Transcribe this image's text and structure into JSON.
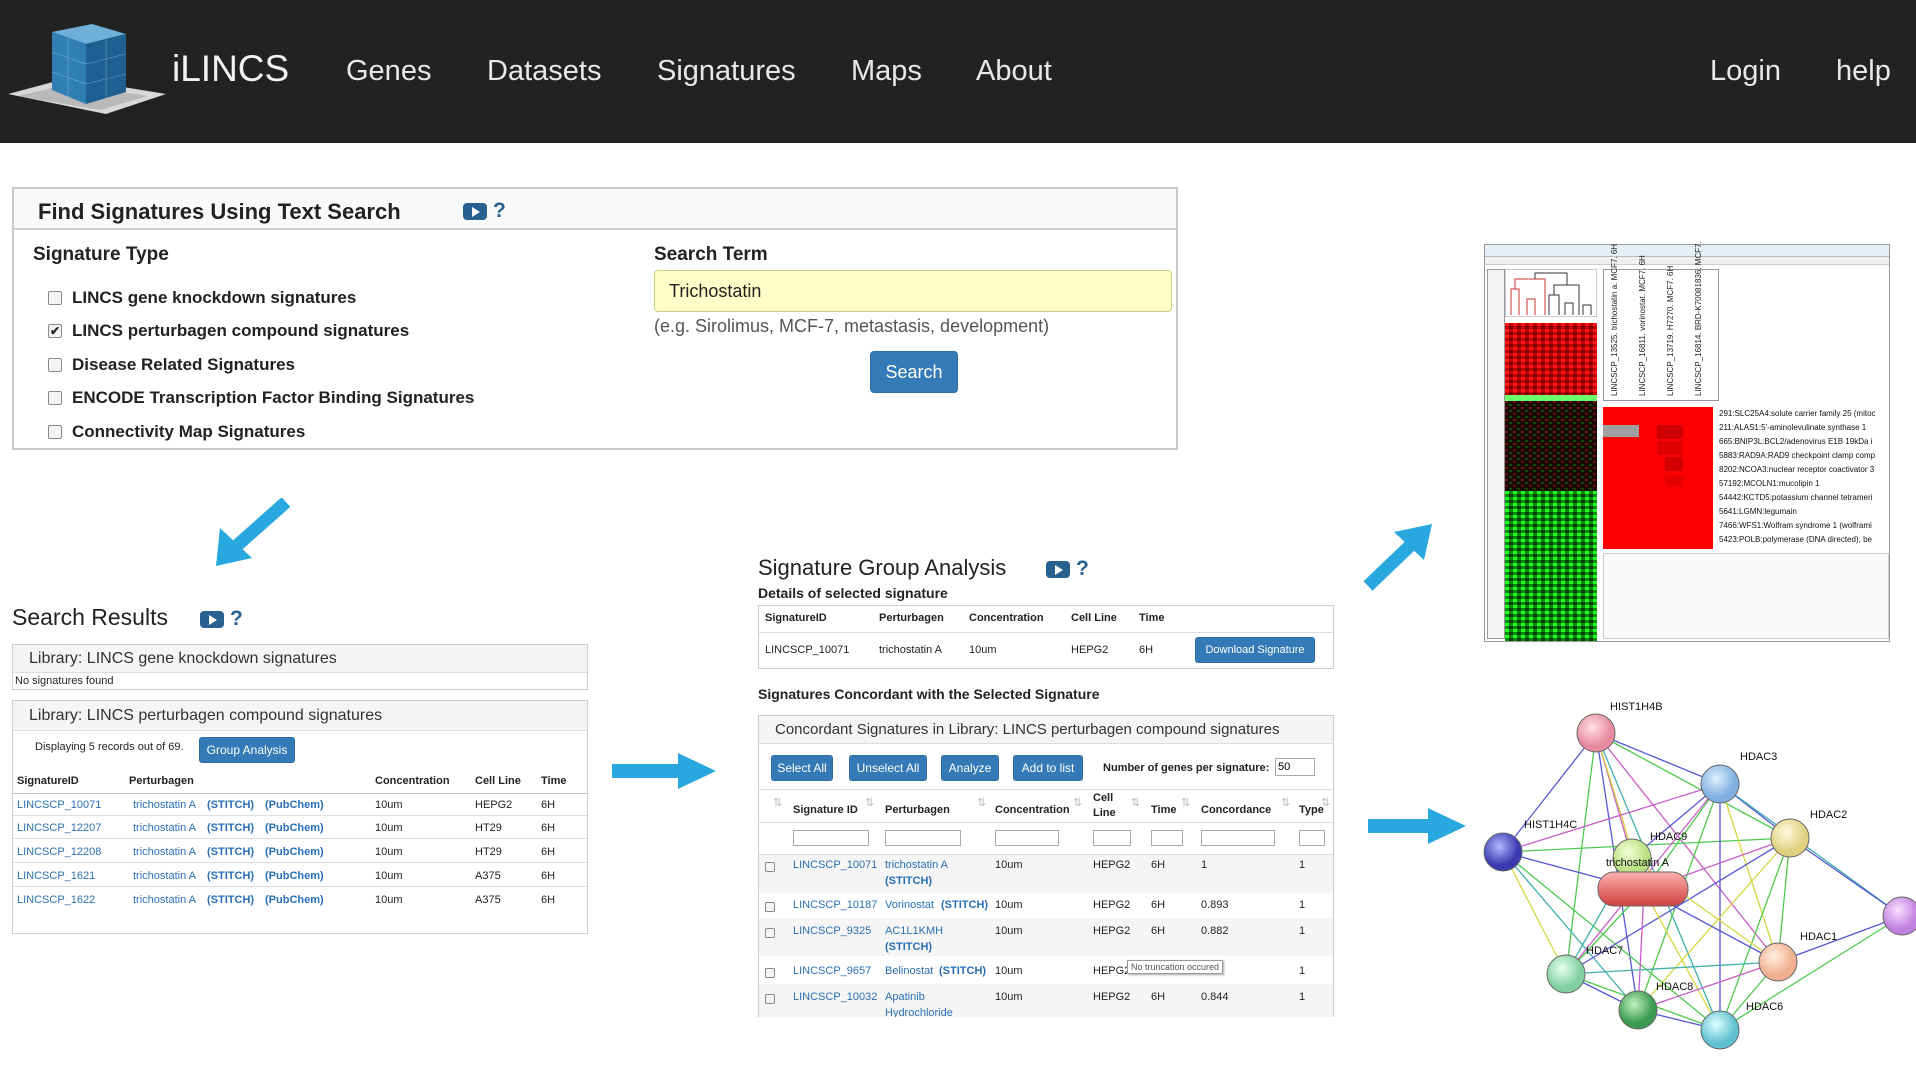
{
  "navbar": {
    "brand": "iLINCS",
    "links": [
      "Genes",
      "Datasets",
      "Signatures",
      "Maps",
      "About"
    ],
    "login": "Login",
    "help": "help"
  },
  "find": {
    "title": "Find Signatures Using Text Search",
    "signature_type_label": "Signature Type",
    "types": [
      {
        "label": "LINCS gene knockdown signatures",
        "checked": false
      },
      {
        "label": "LINCS perturbagen compound signatures",
        "checked": true
      },
      {
        "label": "Disease Related Signatures",
        "checked": false
      },
      {
        "label": "ENCODE Transcription Factor Binding Signatures",
        "checked": false
      },
      {
        "label": "Connectivity Map Signatures",
        "checked": false
      }
    ],
    "search_term_label": "Search Term",
    "search_value": "Trichostatin",
    "hint": "(e.g. Sirolimus, MCF-7, metastasis, development)",
    "search_button": "Search",
    "help_mark": "?"
  },
  "results": {
    "title": "Search Results",
    "help_mark": "?",
    "lib1": {
      "title": "Library: LINCS gene knockdown signatures",
      "empty": "No signatures found"
    },
    "lib2": {
      "title": "Library: LINCS perturbagen compound signatures",
      "count_text": "Displaying 5 records out of 69.",
      "group_button": "Group Analysis",
      "columns": [
        "SignatureID",
        "Perturbagen",
        "Concentration",
        "Cell Line",
        "Time"
      ],
      "rows": [
        {
          "id": "LINCSCP_10071",
          "pert": "trichostatin A",
          "stitch": "(STITCH)",
          "pubchem": "(PubChem)",
          "conc": "10um",
          "cell": "HEPG2",
          "time": "6H"
        },
        {
          "id": "LINCSCP_12207",
          "pert": "trichostatin A",
          "stitch": "(STITCH)",
          "pubchem": "(PubChem)",
          "conc": "10um",
          "cell": "HT29",
          "time": "6H"
        },
        {
          "id": "LINCSCP_12208",
          "pert": "trichostatin A",
          "stitch": "(STITCH)",
          "pubchem": "(PubChem)",
          "conc": "10um",
          "cell": "HT29",
          "time": "6H"
        },
        {
          "id": "LINCSCP_1621",
          "pert": "trichostatin A",
          "stitch": "(STITCH)",
          "pubchem": "(PubChem)",
          "conc": "10um",
          "cell": "A375",
          "time": "6H"
        },
        {
          "id": "LINCSCP_1622",
          "pert": "trichostatin A",
          "stitch": "(STITCH)",
          "pubchem": "(PubChem)",
          "conc": "10um",
          "cell": "A375",
          "time": "6H"
        }
      ]
    }
  },
  "sga": {
    "title": "Signature Group Analysis",
    "help_mark": "?",
    "details_label": "Details of selected signature",
    "columns": [
      "SignatureID",
      "Perturbagen",
      "Concentration",
      "Cell Line",
      "Time"
    ],
    "row": {
      "id": "LINCSCP_10071",
      "pert": "trichostatin A",
      "conc": "10um",
      "cell": "HEPG2",
      "time": "6H"
    },
    "download_button": "Download Signature",
    "concordant_label": "Signatures Concordant with the Selected Signature",
    "concordant_box_title": "Concordant Signatures in Library: LINCS perturbagen compound signatures",
    "buttons": [
      "Select All",
      "Unselect All",
      "Analyze",
      "Add to list"
    ],
    "genes_label": "Number of genes per signature:",
    "genes_value": "50",
    "table_columns": [
      "Signature ID",
      "Perturbagen",
      "Concentration",
      "Cell Line",
      "Time",
      "Concordance",
      "Type"
    ],
    "table_rows": [
      {
        "id": "LINCSCP_10071",
        "pert": "trichostatin A",
        "pert2": "(STITCH)",
        "conc": "10um",
        "cell": "HEPG2",
        "time": "6H",
        "concordance": "1",
        "type": "1"
      },
      {
        "id": "LINCSCP_10187",
        "pert": "Vorinostat",
        "pert_stitch": "(STITCH)",
        "conc": "10um",
        "cell": "HEPG2",
        "time": "6H",
        "concordance": "0.893",
        "type": "1"
      },
      {
        "id": "LINCSCP_9325",
        "pert": "AC1L1KMH",
        "pert2": "(STITCH)",
        "conc": "10um",
        "cell": "HEPG2",
        "time": "6H",
        "concordance": "0.882",
        "type": "1"
      },
      {
        "id": "LINCSCP_9657",
        "pert": "Belinostat",
        "pert_stitch": "(STITCH)",
        "conc": "10um",
        "cell": "HEPG2",
        "time": "",
        "concordance": "",
        "type": "1"
      },
      {
        "id": "LINCSCP_10032",
        "pert": "Apatinib",
        "pert2": "Hydrochloride",
        "conc": "10um",
        "cell": "HEPG2",
        "time": "6H",
        "concordance": "0.844",
        "type": "1"
      }
    ],
    "tooltip": "No truncation occured"
  },
  "heatmap": {
    "column_labels": [
      "LINCSCP_13525. trichostatin a. MCF7. 6H",
      "LINCSCP_16811. vorinostat. MCF7. 6H",
      "LINCSCP_13719. H7270. MCF7. 6H",
      "LINCSCP_16814. BRD-K70081836. MCF7."
    ],
    "genes": [
      "291:SLC25A4:solute carrier family 25 (mitoc",
      "211:ALAS1:5'-aminolevulinate synthase 1",
      "665:BNIP3L:BCL2/adenovirus E1B 19kDa i",
      "5883:RAD9A:RAD9 checkpoint clamp comp",
      "8202:NCOA3:nuclear receptor coactivator 3",
      "57192:MCOLN1:mucolipin 1",
      "54442:KCTD5:potassium channel tetrameri",
      "5641:LGMN:legumain",
      "7466:WFS1:Wolfram syndrome 1 (wolframi",
      "5423:POLB:polymerase (DNA directed), be"
    ]
  },
  "network": {
    "nodes": [
      "HIST1H4B",
      "HDAC3",
      "HDAC2",
      "HIST1H4C",
      "HDAC9",
      "trichostatin A",
      "HDAC1",
      "HDAC7",
      "HDAC8",
      "HDAC6"
    ]
  },
  "colors": {
    "navbar": "#222222",
    "primary": "#337ab7",
    "link": "#2a6fb5",
    "arrow": "#29a8e0",
    "search_bg": "#ffffc8"
  }
}
